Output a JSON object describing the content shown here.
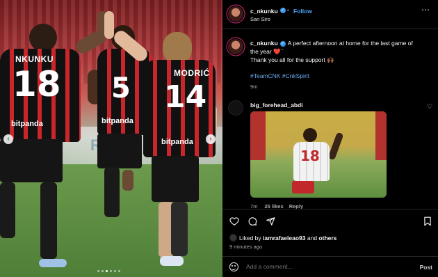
{
  "media": {
    "players": [
      {
        "name": "NKUNKU",
        "number": "18",
        "sponsor": "bitpanda"
      },
      {
        "name": "",
        "number": "5",
        "sponsor": "bitpanda"
      },
      {
        "name": "MODRIĆ",
        "number": "14",
        "sponsor": "bitpanda"
      }
    ],
    "board_text": "Rue",
    "carousel_dots": 6,
    "active_dot": 3
  },
  "header": {
    "username": "c_nkunku",
    "follow_label": "Follow",
    "location": "San Siro",
    "more_icon": "more-horizontal-icon"
  },
  "caption": {
    "username": "c_nkunku",
    "text_line1": "A perfect afternoon at home for the last game of",
    "text_line2": "the year ❤️ ̈",
    "text_line3": "Thank you all for the support 🙌🏾",
    "hashtags": "#TeamCNK #CnkSpirit",
    "time": "9m"
  },
  "comment": {
    "username": "big_forehead_abdi",
    "gif_player_number": "18",
    "time": "7m",
    "likes": "25 likes",
    "reply_label": "Reply"
  },
  "actions": {
    "liked_by_prefix": "Liked by",
    "liked_by_user": "iamrafaeleao93",
    "liked_by_and": "and",
    "liked_by_others": "others",
    "time_ago": "9 minutes ago"
  },
  "comment_bar": {
    "placeholder": "Add a comment...",
    "post_label": "Post"
  },
  "colors": {
    "accent": "#4aa3f5",
    "hashtag": "#6aa8f0",
    "milan_red": "#c8262b"
  }
}
